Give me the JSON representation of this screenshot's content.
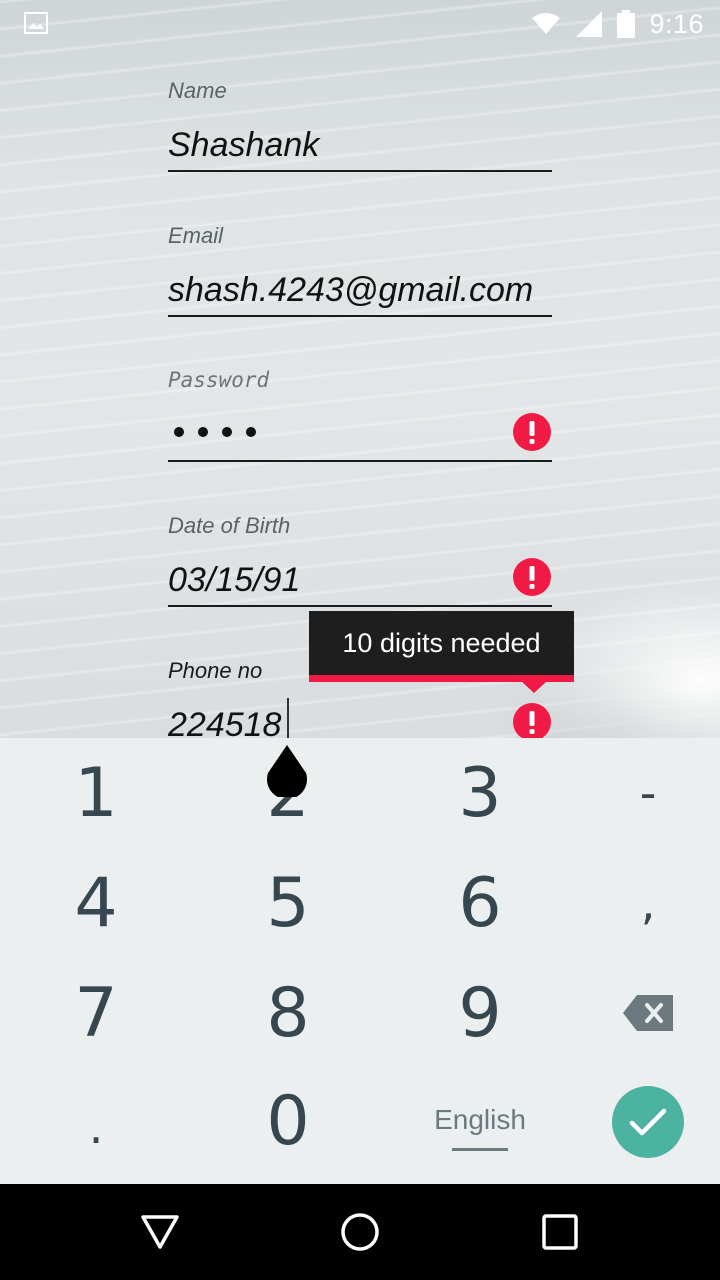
{
  "status_bar": {
    "time": "9:16",
    "icons": [
      "image-icon",
      "wifi-icon",
      "signal-icon",
      "battery-icon"
    ]
  },
  "form": {
    "name": {
      "label": "Name",
      "value": "Shashank"
    },
    "email": {
      "label": "Email",
      "value": "shash.4243@gmail.com"
    },
    "password": {
      "label": "Password",
      "masked_length": 4,
      "has_error": true
    },
    "dob": {
      "label": "Date of Birth",
      "value": "03/15/91",
      "has_error": true
    },
    "phone": {
      "label": "Phone no",
      "value": "224518",
      "has_error": true
    }
  },
  "tooltip": {
    "text": "10 digits needed"
  },
  "keyboard": {
    "rows": [
      [
        "1",
        "2",
        "3",
        "-"
      ],
      [
        "4",
        "5",
        "6",
        ","
      ],
      [
        "7",
        "8",
        "9",
        "backspace"
      ],
      [
        ".",
        "0",
        "English",
        "done"
      ]
    ],
    "language_label": "English"
  },
  "colors": {
    "error_red": "#f01a45",
    "tooltip_bg": "#1e1e1e",
    "enter_teal": "#4bb3a0",
    "key_text": "#37474f",
    "keyboard_bg": "#eceff0"
  },
  "navigation": [
    "back-icon",
    "home-icon",
    "recents-icon"
  ]
}
